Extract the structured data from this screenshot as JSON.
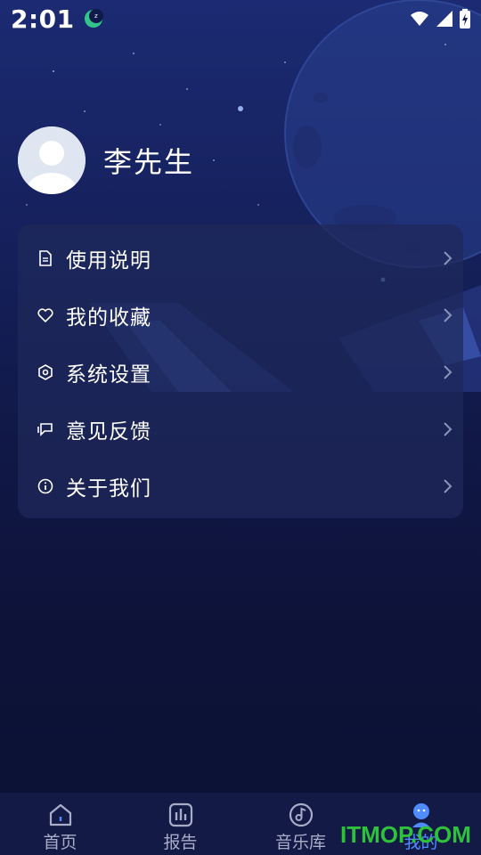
{
  "status_bar": {
    "time": "2:01",
    "icons": [
      "sleep-mode-icon",
      "wifi-icon",
      "signal-icon",
      "battery-charging-icon"
    ]
  },
  "profile": {
    "username": "李先生",
    "avatar_icon": "default-avatar-icon"
  },
  "menu": {
    "items": [
      {
        "label": "使用说明",
        "icon": "document-icon"
      },
      {
        "label": "我的收藏",
        "icon": "heart-icon"
      },
      {
        "label": "系统设置",
        "icon": "settings-icon"
      },
      {
        "label": "意见反馈",
        "icon": "feedback-icon"
      },
      {
        "label": "关于我们",
        "icon": "info-icon"
      }
    ]
  },
  "tab_bar": {
    "tabs": [
      {
        "label": "首页",
        "icon": "home-icon"
      },
      {
        "label": "报告",
        "icon": "report-icon"
      },
      {
        "label": "音乐库",
        "icon": "music-icon"
      },
      {
        "label": "我的",
        "icon": "profile-icon",
        "active": true
      }
    ]
  },
  "watermark": "ITMOP.COM",
  "colors": {
    "accent": "#4f8cff",
    "background": "#0d1238",
    "card": "#1e285a",
    "watermark": "#2ec23a"
  }
}
